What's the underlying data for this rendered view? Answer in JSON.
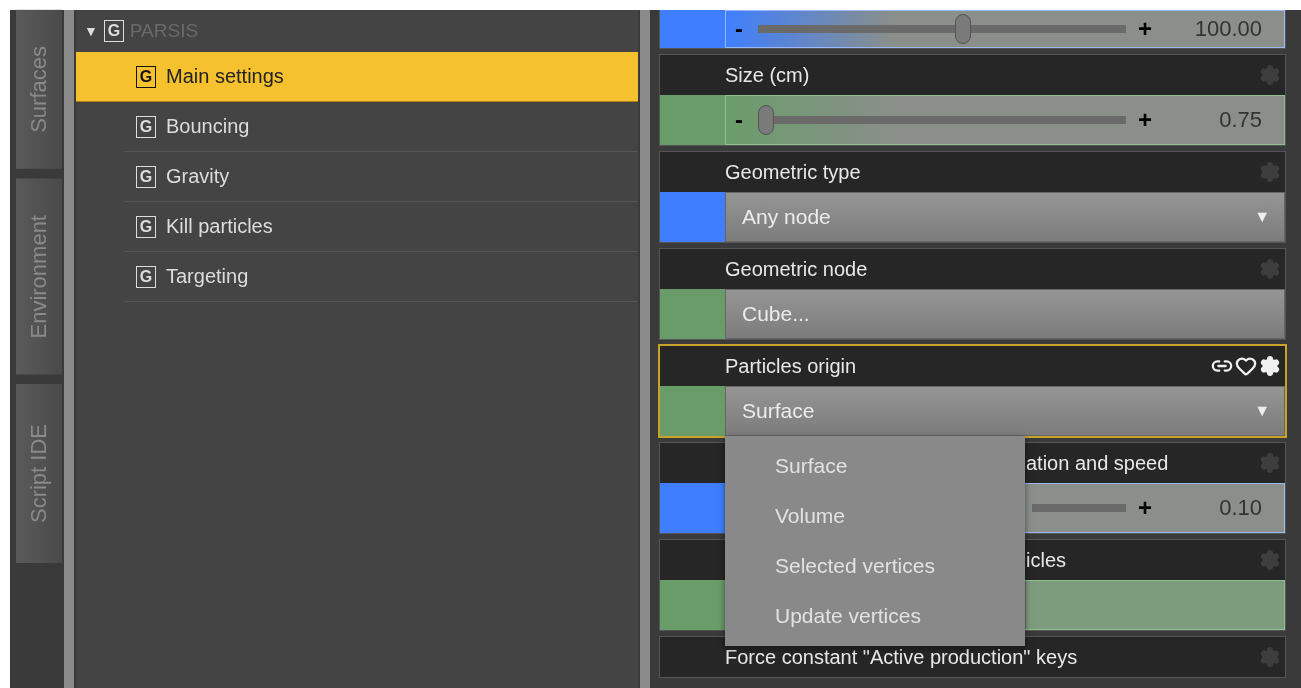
{
  "side_tabs": [
    {
      "label": "Surfaces"
    },
    {
      "label": "Environment"
    },
    {
      "label": "Script IDE"
    }
  ],
  "tree": {
    "label": "PARSIS",
    "badge": "G",
    "expanded": true,
    "children": [
      {
        "label": "Main settings",
        "badge": "G",
        "selected": true
      },
      {
        "label": "Bouncing",
        "badge": "G",
        "selected": false
      },
      {
        "label": "Gravity",
        "badge": "G",
        "selected": false
      },
      {
        "label": "Kill particles",
        "badge": "G",
        "selected": false
      },
      {
        "label": "Targeting",
        "badge": "G",
        "selected": false
      }
    ]
  },
  "properties": [
    {
      "kind": "slider",
      "color": "#3f7fff",
      "level": 0.56,
      "minus": "-",
      "plus": "+",
      "value": "100.00"
    },
    {
      "kind": "slider",
      "label": "Size (cm)",
      "color": "#6a9c6a",
      "level": 0,
      "minus": "-",
      "plus": "+",
      "value": "0.75"
    },
    {
      "kind": "dropdown",
      "label": "Geometric type",
      "color": "#3f7fff",
      "value": "Any node",
      "arrow": "▼"
    },
    {
      "kind": "field",
      "label": "Geometric node",
      "color": "#6a9c6a",
      "value": "Cube..."
    },
    {
      "kind": "dropdown",
      "label": "Particles origin",
      "color": "#6a9c6a",
      "value": "Surface",
      "arrow": "▼",
      "focused": true,
      "open": true,
      "options": [
        {
          "label": "Surface"
        },
        {
          "label": "Volume"
        },
        {
          "label": "Selected vertices"
        },
        {
          "label": "Update vertices"
        }
      ]
    },
    {
      "kind": "slider",
      "label": "ation and speed",
      "color": "#3f7fff",
      "covered": true,
      "plus": "+",
      "value": "0.10"
    },
    {
      "kind": "bar",
      "label": "icles",
      "color": "#6a9c6a",
      "covered": true
    },
    {
      "kind": "header",
      "label": "Force constant \"Active production\" keys"
    }
  ]
}
